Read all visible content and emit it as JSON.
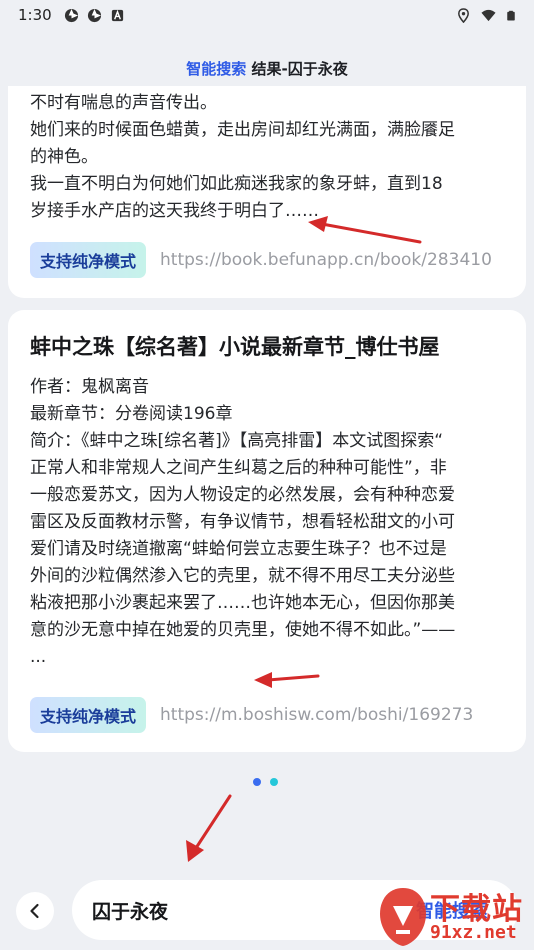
{
  "status_bar": {
    "time": "1:30",
    "left_icons": [
      "aperture-icon",
      "aperture-icon",
      "notification-a-icon"
    ],
    "right_icons": [
      "location-icon",
      "wifi-icon",
      "battery-icon"
    ]
  },
  "header": {
    "accent": "智能搜索",
    "title": "结果-囚于永夜",
    "accent_color": "#2f5be6"
  },
  "results": [
    {
      "body_lines": [
        "不时有喘息的声音传出。",
        "她们来的时候面色蜡黄，走出房间却红光满面，满脸餍足",
        "的神色。",
        "我一直不明白为何她们如此痴迷我家的象牙蚌，直到18",
        "岁接手水产店的这天我终于明白了……"
      ],
      "pure_mode_label": "支持纯净模式",
      "url": "https://book.befunapp.cn/book/283410"
    },
    {
      "title": "蚌中之珠【综名著】小说最新章节_博仕书屋",
      "body_lines": [
        "作者：鬼枫离音",
        "最新章节：分卷阅读196章",
        "简介：《蚌中之珠[综名著]》【高亮排雷】本文试图探索“",
        "正常人和非常规人之间产生纠葛之后的种种可能性”，非",
        "一般恋爱苏文，因为人物设定的必然发展，会有种种恋爱",
        "雷区及反面教材示警，有争议情节，想看轻松甜文的小可",
        "爱们请及时绕道撤离“蚌蛤何尝立志要生珠子？也不过是",
        "外间的沙粒偶然渗入它的壳里，就不得不用尽工夫分泌些",
        "粘液把那小沙裹起来罢了……也许她本无心，但因你那美",
        "意的沙无意中掉在她爱的贝壳里，使她不得不如此。”——",
        "..."
      ],
      "pure_mode_label": "支持纯净模式",
      "url": "https://m.boshisw.com/boshi/169273"
    }
  ],
  "pager": {
    "count": 2,
    "active": 0
  },
  "bottom": {
    "back_icon": "chevron-left-icon",
    "search_value": "囚于永夜",
    "search_button": "智能搜索"
  },
  "watermark": {
    "line1": "下载站",
    "line2": "91xz.net",
    "color": "#e03a2e"
  },
  "annotation_color": "#d42a2a"
}
